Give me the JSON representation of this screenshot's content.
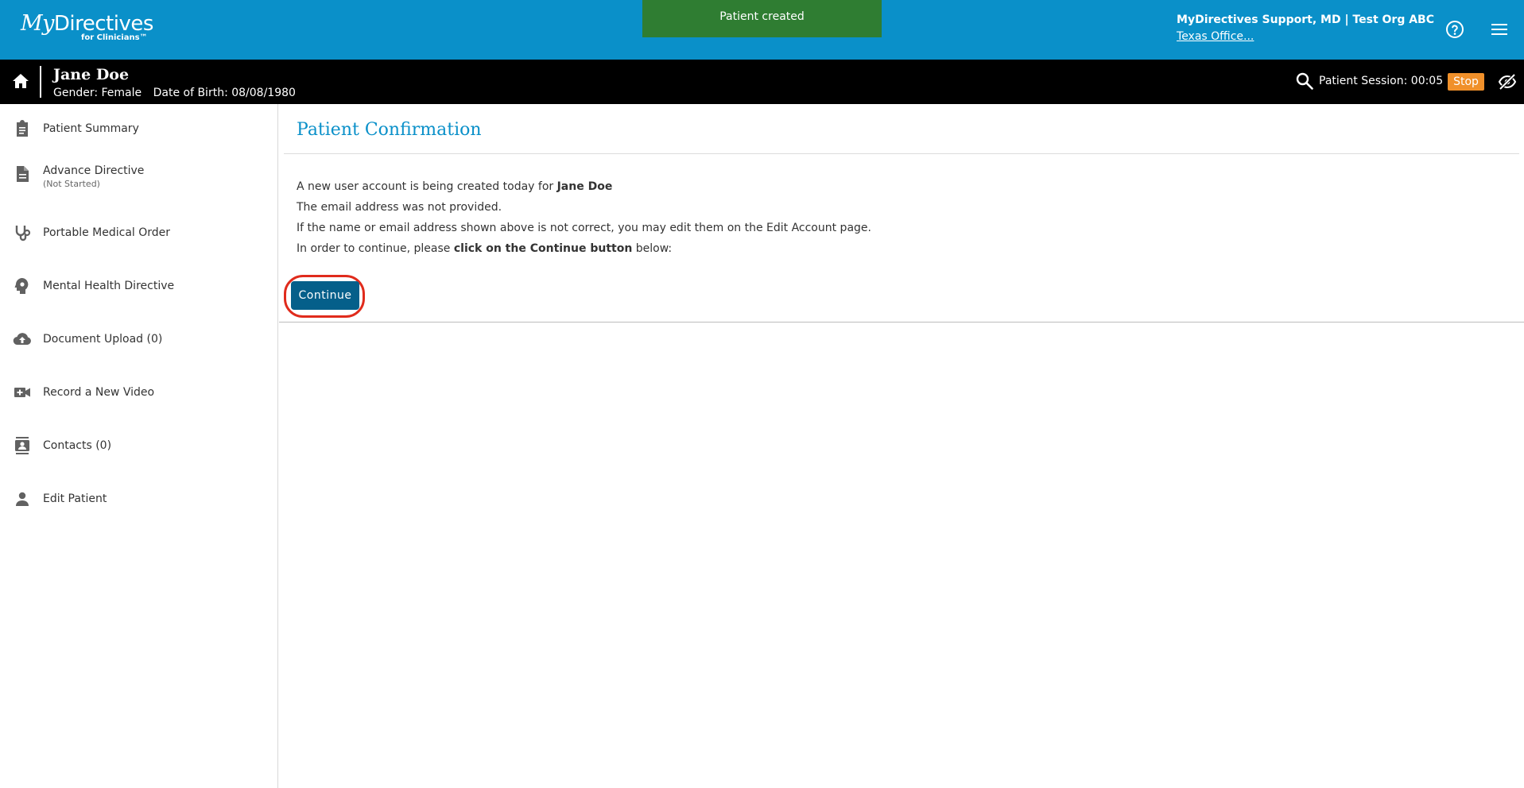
{
  "brand": {
    "logo_main_prefix": "My",
    "logo_main_suffix": "Directives",
    "logo_sub": "for Clinicians™",
    "colors": {
      "header": "#0a90c9",
      "patient_bar": "#000000",
      "title": "#0a90c9",
      "button": "#055f8a",
      "stop": "#f0902a",
      "toast": "#2f7d32",
      "highlight_ring": "#e02b1c"
    }
  },
  "toast": {
    "message": "Patient created"
  },
  "header": {
    "user": "MyDirectives Support, MD | Test Org ABC",
    "office": "Texas Office...",
    "help_icon": "help-circle-icon",
    "menu_icon": "hamburger-menu-icon"
  },
  "patient": {
    "name": "Jane Doe",
    "gender": "Gender: Female",
    "dob": "Date of Birth: 08/08/1980",
    "session": "Patient Session: 00:05",
    "stop_label": "Stop"
  },
  "sidebar": {
    "items": [
      {
        "label": "Patient Summary",
        "icon": "clipboard-icon"
      },
      {
        "label": "Advance Directive",
        "sub": "(Not Started)",
        "icon": "document-icon"
      },
      {
        "label": "Portable Medical Order",
        "icon": "stethoscope-icon"
      },
      {
        "label": "Mental Health Directive",
        "icon": "head-gear-icon"
      },
      {
        "label": "Document Upload (0)",
        "icon": "cloud-upload-icon"
      },
      {
        "label": "Record a New Video",
        "icon": "video-plus-icon"
      },
      {
        "label": "Contacts (0)",
        "icon": "contacts-icon"
      },
      {
        "label": "Edit Patient",
        "icon": "person-icon"
      }
    ]
  },
  "main": {
    "title": "Patient Confirmation",
    "line1_prefix": "A new user account is being created today for ",
    "line1_name": "Jane Doe",
    "line2": "The email address was not provided.",
    "line3": "If the name or email address shown above is not correct, you may edit them on the Edit Account page.",
    "line4_prefix": "In order to continue, please ",
    "line4_bold": "click on the Continue button",
    "line4_suffix": " below:",
    "continue_label": "Continue"
  }
}
